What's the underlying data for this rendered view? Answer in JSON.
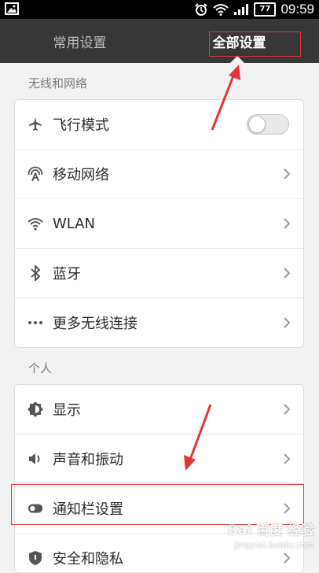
{
  "status_bar": {
    "battery": "77",
    "time": "09:59"
  },
  "tabs": [
    {
      "label": "常用设置",
      "active": false
    },
    {
      "label": "全部设置",
      "active": true
    }
  ],
  "sections": [
    {
      "title": "无线和网络",
      "items": [
        {
          "label": "飞行模式",
          "icon": "airplane-icon",
          "control": "toggle",
          "toggle_on": false
        },
        {
          "label": "移动网络",
          "icon": "mobile-network-icon",
          "control": "chevron"
        },
        {
          "label": "WLAN",
          "icon": "wifi-icon",
          "control": "chevron"
        },
        {
          "label": "蓝牙",
          "icon": "bluetooth-icon",
          "control": "chevron"
        },
        {
          "label": "更多无线连接",
          "icon": "more-dots-icon",
          "control": "chevron"
        }
      ]
    },
    {
      "title": "个人",
      "items": [
        {
          "label": "显示",
          "icon": "brightness-icon",
          "control": "chevron"
        },
        {
          "label": "声音和振动",
          "icon": "speaker-icon",
          "control": "chevron"
        },
        {
          "label": "通知栏设置",
          "icon": "notification-toggle-icon",
          "control": "chevron"
        },
        {
          "label": "安全和隐私",
          "icon": "shield-icon",
          "control": "chevron"
        }
      ]
    }
  ],
  "watermark": {
    "brand": "Bai 百度 经验",
    "url": "jingyan.baidu.com"
  },
  "colors": {
    "tab_bar": "#373737",
    "annotation_red": "#e23636",
    "background": "#f2f2f2"
  }
}
